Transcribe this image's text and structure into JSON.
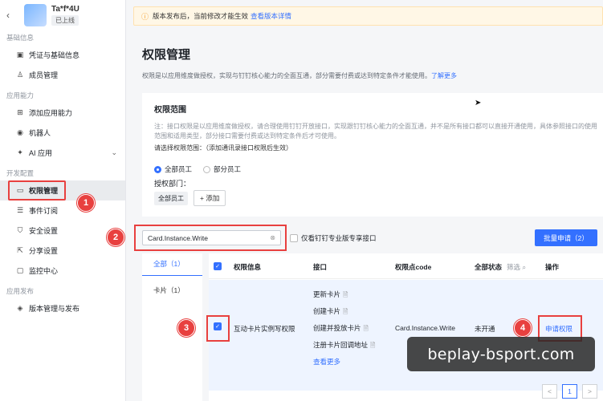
{
  "app": {
    "name": "Ta*f*4U",
    "status": "已上线"
  },
  "sidebar": {
    "sections": [
      {
        "title": "基础信息",
        "items": [
          {
            "label": "凭证与基础信息",
            "icon": "credential-icon"
          },
          {
            "label": "成员管理",
            "icon": "user-icon"
          }
        ]
      },
      {
        "title": "应用能力",
        "items": [
          {
            "label": "添加应用能力",
            "icon": "grid-icon"
          },
          {
            "label": "机器人",
            "icon": "robot-icon"
          },
          {
            "label": "AI 应用",
            "icon": "ai-icon"
          }
        ]
      },
      {
        "title": "开发配置",
        "items": [
          {
            "label": "权限管理",
            "icon": "permission-icon"
          },
          {
            "label": "事件订阅",
            "icon": "event-icon"
          },
          {
            "label": "安全设置",
            "icon": "shield-icon"
          },
          {
            "label": "分享设置",
            "icon": "share-icon"
          },
          {
            "label": "监控中心",
            "icon": "monitor-icon"
          }
        ]
      },
      {
        "title": "应用发布",
        "items": [
          {
            "label": "版本管理与发布",
            "icon": "version-icon"
          }
        ]
      }
    ]
  },
  "notice": {
    "text": "版本发布后，当前修改才能生效",
    "link": "查看版本详情"
  },
  "page": {
    "title": "权限管理",
    "desc": "权限是以应用维度做授权，实现与钉钉核心能力的全面互通，部分需要付费或达到特定条件才能使用。",
    "desc_link": "了解更多"
  },
  "scope": {
    "title": "权限范围",
    "note": "注：接口权限是以应用维度做授权，请合理使用钉钉开放接口，实现跟钉钉核心能力的全面互通，并不是所有接口都可以直接开通使用，具体参照接口的使用范围和适用类型，部分接口需要付费或达到特定条件后才可使用。",
    "select_label": "请选择权限范围：（添加通讯录接口权限后生效）",
    "options": [
      "全部员工",
      "部分员工"
    ],
    "dept_label": "授权部门：",
    "dept_tag": "全部员工",
    "add_label": "+ 添加"
  },
  "search": {
    "value": "Card.Instance.Write",
    "only_pro": "仅看钉钉专业版专享接口",
    "batch": "批量申请（2）"
  },
  "categories": [
    {
      "label": "全部（1）"
    },
    {
      "label": "卡片（1）"
    }
  ],
  "table": {
    "headers": {
      "info": "权限信息",
      "iface": "接口",
      "code": "权限点code",
      "status": "全部状态",
      "filter": "筛选 ⌕",
      "ops": "操作"
    },
    "row": {
      "name": "互动卡片实例写权限",
      "interfaces": [
        "更新卡片",
        "创建卡片",
        "创建并投放卡片",
        "注册卡片回调地址"
      ],
      "more": "查看更多",
      "code": "Card.Instance.Write",
      "status": "未开通",
      "action": "申请权限"
    }
  },
  "pager": {
    "prev": "<",
    "current": "1",
    "next": ">"
  },
  "badges": [
    "1",
    "2",
    "3",
    "4"
  ],
  "watermark": "beplay-bsport.com"
}
